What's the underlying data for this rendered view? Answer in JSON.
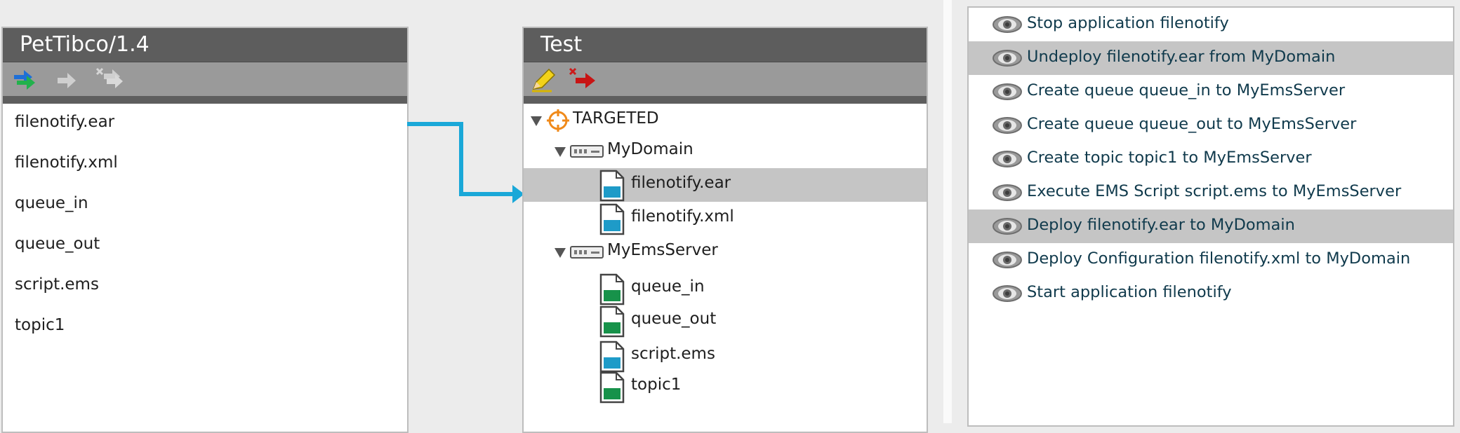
{
  "package_panel": {
    "title": "PetTibco/1.4",
    "toolbar": [
      "deploy-arrow-icon",
      "forward-arrow-icon",
      "remove-arrow-icon"
    ],
    "items": [
      "filenotify.ear",
      "filenotify.xml",
      "queue_in",
      "queue_out",
      "script.ems",
      "topic1"
    ]
  },
  "environment_panel": {
    "title": "Test",
    "toolbar": [
      "pencil-icon",
      "remove-red-arrow-icon"
    ],
    "tree": {
      "root": "TARGETED",
      "domain": {
        "name": "MyDomain",
        "children": [
          "filenotify.ear",
          "filenotify.xml"
        ],
        "selected": "filenotify.ear"
      },
      "ems": {
        "name": "MyEmsServer",
        "children": [
          "queue_in",
          "queue_out",
          "script.ems",
          "topic1"
        ]
      }
    }
  },
  "steps_panel": {
    "steps": [
      {
        "text": "Stop application filenotify",
        "selected": false
      },
      {
        "text": "Undeploy filenotify.ear from MyDomain",
        "selected": true
      },
      {
        "text": "Create queue queue_in to MyEmsServer",
        "selected": false
      },
      {
        "text": "Create queue queue_out to MyEmsServer",
        "selected": false
      },
      {
        "text": "Create topic topic1 to MyEmsServer",
        "selected": false
      },
      {
        "text": "Execute EMS Script script.ems to MyEmsServer",
        "selected": false
      },
      {
        "text": "Deploy filenotify.ear to MyDomain",
        "selected": true
      },
      {
        "text": "Deploy Configuration filenotify.xml to MyDomain",
        "selected": false
      },
      {
        "text": "Start application filenotify",
        "selected": false
      }
    ]
  },
  "colors": {
    "header": "#5d5d5d",
    "toolbar": "#9a9a9a",
    "selection": "#c5c5c5",
    "arrow": "#1aa8d8",
    "step_text": "#103a4c",
    "file_blue": "#1e9bc8",
    "file_green": "#17924a"
  }
}
